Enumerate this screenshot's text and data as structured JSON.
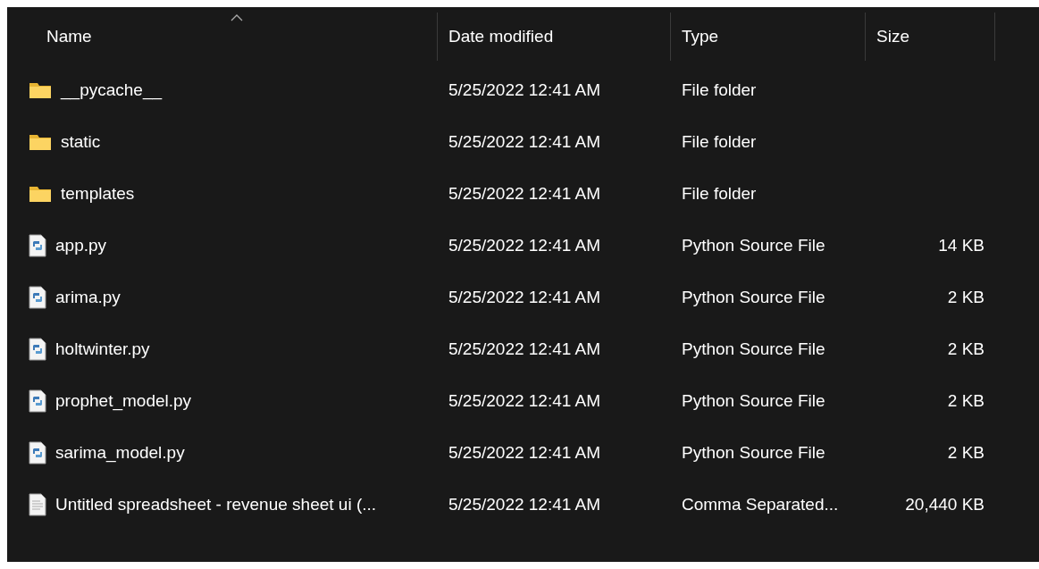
{
  "columns": [
    {
      "label": "Name",
      "sorted": true
    },
    {
      "label": "Date modified",
      "sorted": false
    },
    {
      "label": "Type",
      "sorted": false
    },
    {
      "label": "Size",
      "sorted": false
    }
  ],
  "files": [
    {
      "kind": "folder",
      "name": "__pycache__",
      "date": "5/25/2022 12:41 AM",
      "type": "File folder"
    },
    {
      "kind": "folder",
      "name": "static",
      "date": "5/25/2022 12:41 AM",
      "type": "File folder"
    },
    {
      "kind": "folder",
      "name": "templates",
      "date": "5/25/2022 12:41 AM",
      "type": "File folder"
    },
    {
      "kind": "python",
      "name": "app.py",
      "date": "5/25/2022 12:41 AM",
      "type": "Python Source File",
      "size": "14 KB"
    },
    {
      "kind": "python",
      "name": "arima.py",
      "date": "5/25/2022 12:41 AM",
      "type": "Python Source File",
      "size": "2 KB"
    },
    {
      "kind": "python",
      "name": "holtwinter.py",
      "date": "5/25/2022 12:41 AM",
      "type": "Python Source File",
      "size": "2 KB"
    },
    {
      "kind": "python",
      "name": "prophet_model.py",
      "date": "5/25/2022 12:41 AM",
      "type": "Python Source File",
      "size": "2 KB"
    },
    {
      "kind": "python",
      "name": "sarima_model.py",
      "date": "5/25/2022 12:41 AM",
      "type": "Python Source File",
      "size": "2 KB"
    },
    {
      "kind": "text",
      "name": "Untitled spreadsheet - revenue sheet ui (...",
      "date": "5/25/2022 12:41 AM",
      "type": "Comma Separated...",
      "size": "20,440 KB"
    }
  ]
}
